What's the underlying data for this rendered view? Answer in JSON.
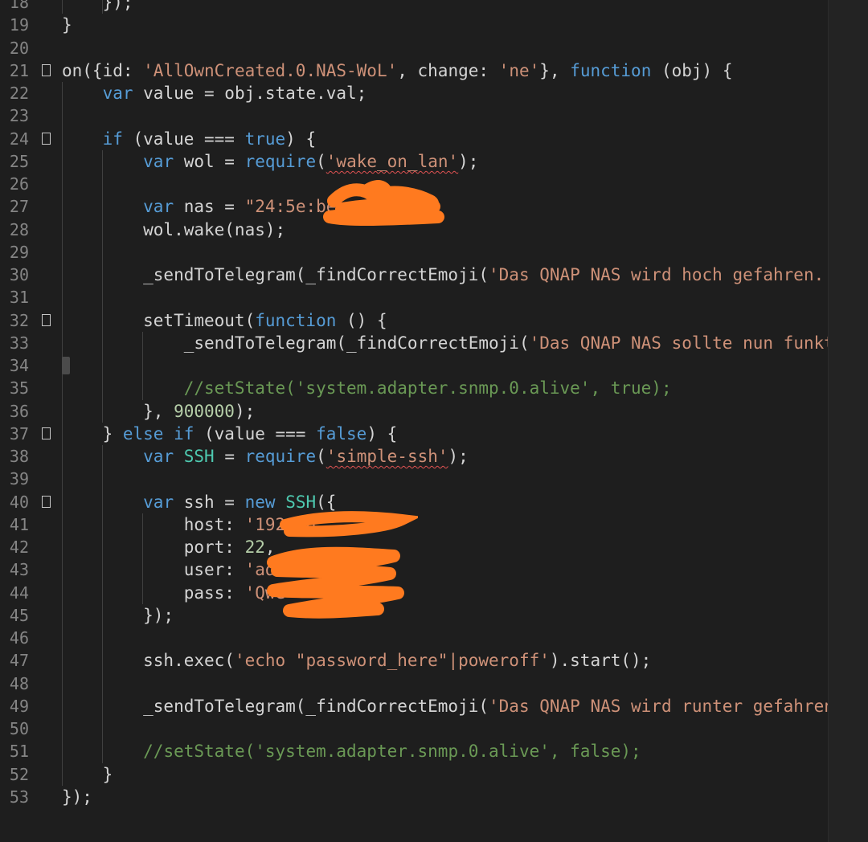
{
  "editor": {
    "language": "javascript",
    "theme_colors": {
      "background": "#1e1e1e",
      "keyword": "#569cd6",
      "string": "#ce9178",
      "number": "#b5cea8",
      "comment": "#6a9955",
      "class": "#4ec9b0",
      "line_number": "#858585",
      "redaction": "#ff7a1f"
    },
    "first_line_partial": "    });",
    "lines": [
      {
        "n": "18",
        "fold": false,
        "guides": 2,
        "tokens": [
          [
            "pl",
            "    });"
          ]
        ]
      },
      {
        "n": "19",
        "fold": false,
        "guides": 0,
        "tokens": [
          [
            "pl",
            "}"
          ]
        ]
      },
      {
        "n": "20",
        "fold": false,
        "guides": 0,
        "tokens": []
      },
      {
        "n": "21",
        "fold": true,
        "guides": 0,
        "tokens": [
          [
            "pl",
            "on({id: "
          ],
          [
            "str",
            "'AllOwnCreated.0.NAS-WoL'"
          ],
          [
            "pl",
            ", change: "
          ],
          [
            "str",
            "'ne'"
          ],
          [
            "pl",
            "}, "
          ],
          [
            "kw",
            "function"
          ],
          [
            "pl",
            " (obj) {"
          ]
        ]
      },
      {
        "n": "22",
        "fold": false,
        "guides": 1,
        "tokens": [
          [
            "pl",
            "    "
          ],
          [
            "kw",
            "var"
          ],
          [
            "pl",
            " value = obj.state.val;"
          ]
        ]
      },
      {
        "n": "23",
        "fold": false,
        "guides": 1,
        "tokens": []
      },
      {
        "n": "24",
        "fold": true,
        "guides": 1,
        "tokens": [
          [
            "pl",
            "    "
          ],
          [
            "kw",
            "if"
          ],
          [
            "pl",
            " (value === "
          ],
          [
            "kw",
            "true"
          ],
          [
            "pl",
            ") {"
          ]
        ]
      },
      {
        "n": "25",
        "fold": false,
        "guides": 2,
        "tokens": [
          [
            "pl",
            "        "
          ],
          [
            "kw",
            "var"
          ],
          [
            "pl",
            " wol = "
          ],
          [
            "kw",
            "require"
          ],
          [
            "pl",
            "("
          ],
          [
            "sqs",
            "'wake_on_lan'"
          ],
          [
            "pl",
            ");"
          ]
        ]
      },
      {
        "n": "26",
        "fold": false,
        "guides": 2,
        "tokens": []
      },
      {
        "n": "27",
        "fold": false,
        "guides": 2,
        "tokens": [
          [
            "pl",
            "        "
          ],
          [
            "kw",
            "var"
          ],
          [
            "pl",
            " nas = "
          ],
          [
            "str",
            "\"24:5e:be:  f7  0\""
          ],
          [
            "pl",
            ";"
          ]
        ]
      },
      {
        "n": "28",
        "fold": false,
        "guides": 2,
        "tokens": [
          [
            "pl",
            "        wol.wake(nas);"
          ]
        ]
      },
      {
        "n": "29",
        "fold": false,
        "guides": 2,
        "tokens": []
      },
      {
        "n": "30",
        "fold": false,
        "guides": 2,
        "tokens": [
          [
            "pl",
            "        _sendToTelegram(_findCorrectEmoji("
          ],
          [
            "str",
            "'Das QNAP NAS wird hoch gefahren.'"
          ],
          [
            "pl",
            ")"
          ]
        ]
      },
      {
        "n": "31",
        "fold": false,
        "guides": 2,
        "tokens": []
      },
      {
        "n": "32",
        "fold": true,
        "guides": 2,
        "tokens": [
          [
            "pl",
            "        setTimeout("
          ],
          [
            "kw",
            "function"
          ],
          [
            "pl",
            " () {"
          ]
        ]
      },
      {
        "n": "33",
        "fold": false,
        "guides": 3,
        "tokens": [
          [
            "pl",
            "            _sendToTelegram(_findCorrectEmoji("
          ],
          [
            "str",
            "'Das QNAP NAS sollte nun funkti"
          ]
        ]
      },
      {
        "n": "34",
        "fold": false,
        "guides": 3,
        "cursor": true,
        "tokens": []
      },
      {
        "n": "35",
        "fold": false,
        "guides": 3,
        "tokens": [
          [
            "pl",
            "            "
          ],
          [
            "cm",
            "//setState('system.adapter.snmp.0.alive', true);"
          ]
        ]
      },
      {
        "n": "36",
        "fold": false,
        "guides": 2,
        "tokens": [
          [
            "pl",
            "        }, "
          ],
          [
            "num",
            "900000"
          ],
          [
            "pl",
            ");"
          ]
        ]
      },
      {
        "n": "37",
        "fold": true,
        "guides": 1,
        "tokens": [
          [
            "pl",
            "    } "
          ],
          [
            "kw",
            "else if"
          ],
          [
            "pl",
            " (value === "
          ],
          [
            "kw",
            "false"
          ],
          [
            "pl",
            ") {"
          ]
        ]
      },
      {
        "n": "38",
        "fold": false,
        "guides": 2,
        "tokens": [
          [
            "pl",
            "        "
          ],
          [
            "kw",
            "var"
          ],
          [
            "pl",
            " "
          ],
          [
            "cls",
            "SSH"
          ],
          [
            "pl",
            " = "
          ],
          [
            "kw",
            "require"
          ],
          [
            "pl",
            "("
          ],
          [
            "sqs",
            "'simple-ssh'"
          ],
          [
            "pl",
            ");"
          ]
        ]
      },
      {
        "n": "39",
        "fold": false,
        "guides": 2,
        "tokens": []
      },
      {
        "n": "40",
        "fold": true,
        "guides": 2,
        "tokens": [
          [
            "pl",
            "        "
          ],
          [
            "kw",
            "var"
          ],
          [
            "pl",
            " ssh = "
          ],
          [
            "kw",
            "new"
          ],
          [
            "pl",
            " "
          ],
          [
            "cls",
            "SSH"
          ],
          [
            "pl",
            "({"
          ]
        ]
      },
      {
        "n": "41",
        "fold": false,
        "guides": 3,
        "tokens": [
          [
            "pl",
            "            host: "
          ],
          [
            "str",
            "'192.16"
          ]
        ]
      },
      {
        "n": "42",
        "fold": false,
        "guides": 3,
        "tokens": [
          [
            "pl",
            "            port: "
          ],
          [
            "num",
            "22"
          ],
          [
            "pl",
            ","
          ]
        ]
      },
      {
        "n": "43",
        "fold": false,
        "guides": 3,
        "tokens": [
          [
            "pl",
            "            user: "
          ],
          [
            "str",
            "'admi"
          ]
        ]
      },
      {
        "n": "44",
        "fold": false,
        "guides": 3,
        "tokens": [
          [
            "pl",
            "            pass: "
          ],
          [
            "str",
            "'Qwe"
          ]
        ]
      },
      {
        "n": "45",
        "fold": false,
        "guides": 2,
        "tokens": [
          [
            "pl",
            "        });"
          ]
        ]
      },
      {
        "n": "46",
        "fold": false,
        "guides": 2,
        "tokens": []
      },
      {
        "n": "47",
        "fold": false,
        "guides": 2,
        "tokens": [
          [
            "pl",
            "        ssh.exec("
          ],
          [
            "str",
            "'echo \"password_here\"|poweroff'"
          ],
          [
            "pl",
            ").start();"
          ]
        ]
      },
      {
        "n": "48",
        "fold": false,
        "guides": 2,
        "tokens": []
      },
      {
        "n": "49",
        "fold": false,
        "guides": 2,
        "tokens": [
          [
            "pl",
            "        _sendToTelegram(_findCorrectEmoji("
          ],
          [
            "str",
            "'Das QNAP NAS wird runter gefahren"
          ]
        ]
      },
      {
        "n": "50",
        "fold": false,
        "guides": 2,
        "tokens": []
      },
      {
        "n": "51",
        "fold": false,
        "guides": 2,
        "tokens": [
          [
            "pl",
            "        "
          ],
          [
            "cm",
            "//setState('system.adapter.snmp.0.alive', false);"
          ]
        ]
      },
      {
        "n": "52",
        "fold": false,
        "guides": 1,
        "tokens": [
          [
            "pl",
            "    }"
          ]
        ]
      },
      {
        "n": "53",
        "fold": false,
        "guides": 0,
        "tokens": [
          [
            "pl",
            "});"
          ]
        ]
      }
    ]
  }
}
